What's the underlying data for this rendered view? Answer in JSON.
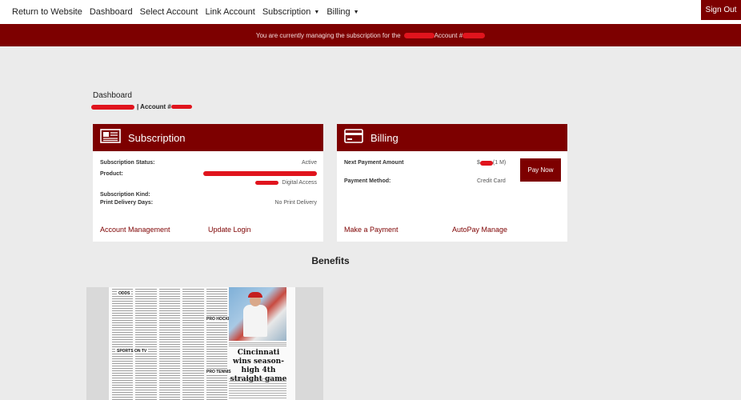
{
  "nav": {
    "items": [
      "Return to Website",
      "Dashboard",
      "Select Account",
      "Link Account"
    ],
    "dropdowns": [
      "Subscription",
      "Billing"
    ],
    "sign_out": "Sign Out"
  },
  "banner": {
    "prefix": "You are currently managing the subscription for the",
    "account_prefix": "Account #"
  },
  "page": {
    "dashboard_label": "Dashboard",
    "account_label": "| Account #"
  },
  "subscription_card": {
    "title": "Subscription",
    "status_label": "Subscription Status:",
    "status_value": "Active",
    "product_label": "Product:",
    "product_value": "Digital Access",
    "kind_label": "Subscription Kind:",
    "delivery_label": "Print Delivery Days:",
    "delivery_value": "No Print Delivery",
    "link_account_management": "Account Management",
    "link_update_login": "Update Login"
  },
  "billing_card": {
    "title": "Billing",
    "next_payment_label": "Next Payment Amount",
    "next_payment_value": "$",
    "next_payment_term": "(1 M)",
    "method_label": "Payment Method:",
    "method_value": "Credit Card",
    "pay_now": "Pay Now",
    "link_make_payment": "Make a Payment",
    "link_autopay": "AutoPay Manage"
  },
  "benefits": {
    "title": "Benefits",
    "newspaper_headline": "Cincinnati wins season-high 4th straight game",
    "section_labels": [
      "ODDS",
      "SPORTS ON TV",
      "PRO HOCKEY",
      "PRO TENNIS"
    ]
  },
  "colors": {
    "brand": "#7d0000",
    "redaction": "#e0141d",
    "page_bg": "#ebebeb"
  }
}
